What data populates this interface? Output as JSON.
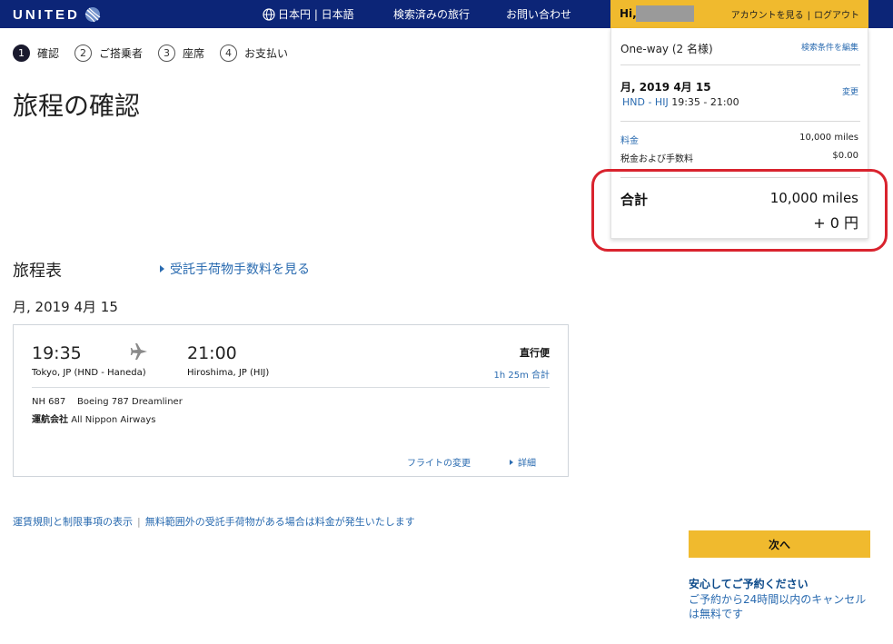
{
  "header": {
    "logo_text": "UNITED",
    "lang": "日本円 | 日本語",
    "recent": "検索済みの旅行",
    "contact": "お問い合わせ",
    "hi": "Hi,",
    "account_link": "アカウントを見る",
    "logout_link": "ログアウト",
    "colors": {
      "navy": "#0c2577",
      "gold": "#f0ba2e"
    }
  },
  "steps": [
    {
      "num": "1",
      "label": "確認"
    },
    {
      "num": "2",
      "label": "ご搭乗者"
    },
    {
      "num": "3",
      "label": "座席"
    },
    {
      "num": "4",
      "label": "お支払い"
    }
  ],
  "page_title": "旅程の確認",
  "itinerary": {
    "title": "旅程表",
    "baggage_link": "受託手荷物手数料を見る",
    "date": "月, 2019 4月 15"
  },
  "flight": {
    "dep_time": "19:35",
    "arr_time": "21:00",
    "dep_city": "Tokyo, JP (HND - Haneda)",
    "arr_city": "Hiroshima, JP (HIJ)",
    "nonstop": "直行便",
    "duration": "1h 25m 合計",
    "flight_no": "NH 687",
    "aircraft": "Boeing 787 Dreamliner",
    "operator_label": "運航会社",
    "operator": "All Nippon Airways",
    "change_flight": "フライトの変更",
    "details": "詳細"
  },
  "footer": {
    "fare_rules": "運賃規則と制限事項の表示",
    "baggage_note": "無料範囲外の受託手荷物がある場合は料金が発生いたします"
  },
  "summary": {
    "trip_type": "One-way (2 名様)",
    "edit_search": "検索条件を編集",
    "date": "月, 2019 4月 15",
    "change": "変更",
    "route_codes": "HND - HIJ",
    "route_times": "19:35 - 21:00",
    "fare_label": "料金",
    "fare_value": "10,000 miles",
    "tax_label": "税金および手数料",
    "tax_value": "$0.00",
    "total_label": "合計",
    "total_miles": "10,000 miles",
    "total_yen": "+ 0 円"
  },
  "next_button": "次へ",
  "assurance": {
    "title": "安心してご予約ください",
    "text": "ご予約から24時間以内のキャンセルは無料です"
  }
}
